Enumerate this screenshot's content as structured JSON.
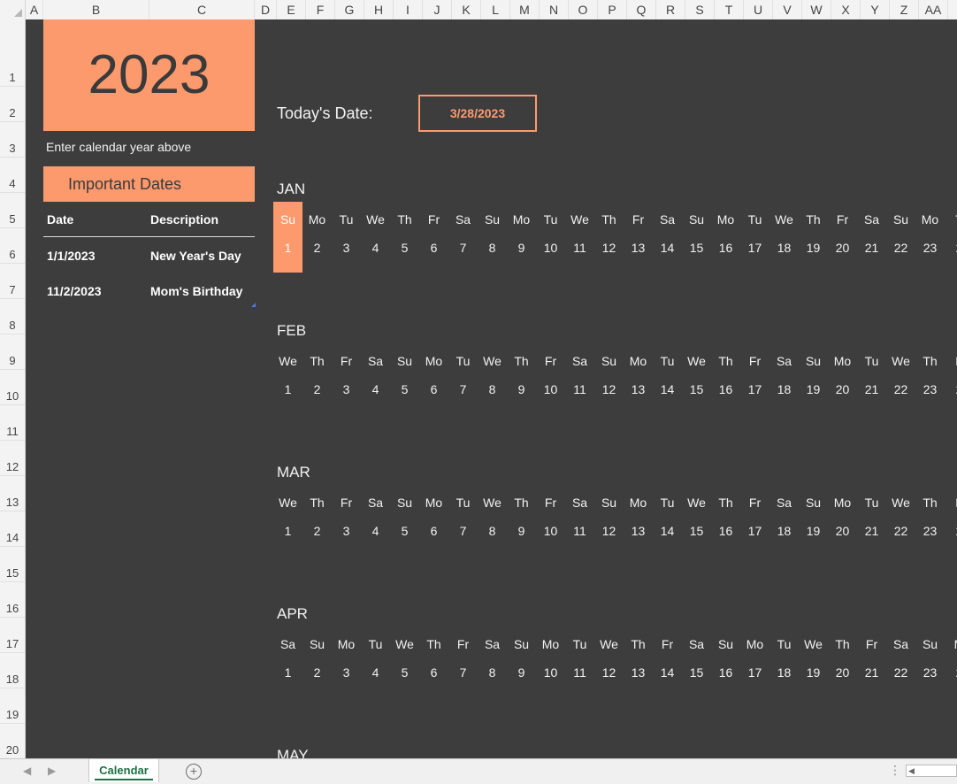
{
  "columns": [
    {
      "label": "A",
      "w": 20
    },
    {
      "label": "B",
      "w": 120
    },
    {
      "label": "C",
      "w": 119
    },
    {
      "label": "D",
      "w": 25
    },
    {
      "label": "E",
      "w": 33
    },
    {
      "label": "F",
      "w": 33
    },
    {
      "label": "G",
      "w": 33
    },
    {
      "label": "H",
      "w": 33
    },
    {
      "label": "I",
      "w": 33
    },
    {
      "label": "J",
      "w": 33
    },
    {
      "label": "K",
      "w": 33
    },
    {
      "label": "L",
      "w": 33
    },
    {
      "label": "M",
      "w": 33
    },
    {
      "label": "N",
      "w": 33
    },
    {
      "label": "O",
      "w": 33
    },
    {
      "label": "P",
      "w": 33
    },
    {
      "label": "Q",
      "w": 33
    },
    {
      "label": "R",
      "w": 33
    },
    {
      "label": "S",
      "w": 33
    },
    {
      "label": "T",
      "w": 33
    },
    {
      "label": "U",
      "w": 33
    },
    {
      "label": "V",
      "w": 33
    },
    {
      "label": "W",
      "w": 33
    },
    {
      "label": "X",
      "w": 33
    },
    {
      "label": "Y",
      "w": 33
    },
    {
      "label": "Z",
      "w": 33
    },
    {
      "label": "AA",
      "w": 33
    },
    {
      "label": "A",
      "w": 33
    }
  ],
  "rows": [
    "1",
    "2",
    "3",
    "4",
    "5",
    "6",
    "7",
    "8",
    "9",
    "10",
    "11",
    "12",
    "13",
    "14",
    "15",
    "16",
    "17",
    "18",
    "19",
    "20"
  ],
  "year": "2023",
  "year_hint": "Enter calendar year above",
  "important_dates": {
    "header": "Important Dates",
    "col_date": "Date",
    "col_desc": "Description",
    "events": [
      {
        "date": "1/1/2023",
        "desc": "New Year's Day"
      },
      {
        "date": "11/2/2023",
        "desc": "Mom's Birthday"
      }
    ]
  },
  "today": {
    "label": "Today's Date:",
    "value": "3/28/2023"
  },
  "months": [
    {
      "name": "JAN",
      "days": [
        "Su",
        "Mo",
        "Tu",
        "We",
        "Th",
        "Fr",
        "Sa",
        "Su",
        "Mo",
        "Tu",
        "We",
        "Th",
        "Fr",
        "Sa",
        "Su",
        "Mo",
        "Tu",
        "We",
        "Th",
        "Fr",
        "Sa",
        "Su",
        "Mo",
        "T"
      ],
      "highlight": 0
    },
    {
      "name": "FEB",
      "days": [
        "We",
        "Th",
        "Fr",
        "Sa",
        "Su",
        "Mo",
        "Tu",
        "We",
        "Th",
        "Fr",
        "Sa",
        "Su",
        "Mo",
        "Tu",
        "We",
        "Th",
        "Fr",
        "Sa",
        "Su",
        "Mo",
        "Tu",
        "We",
        "Th",
        "F"
      ]
    },
    {
      "name": "MAR",
      "days": [
        "We",
        "Th",
        "Fr",
        "Sa",
        "Su",
        "Mo",
        "Tu",
        "We",
        "Th",
        "Fr",
        "Sa",
        "Su",
        "Mo",
        "Tu",
        "We",
        "Th",
        "Fr",
        "Sa",
        "Su",
        "Mo",
        "Tu",
        "We",
        "Th",
        "F"
      ]
    },
    {
      "name": "APR",
      "days": [
        "Sa",
        "Su",
        "Mo",
        "Tu",
        "We",
        "Th",
        "Fr",
        "Sa",
        "Su",
        "Mo",
        "Tu",
        "We",
        "Th",
        "Fr",
        "Sa",
        "Su",
        "Mo",
        "Tu",
        "We",
        "Th",
        "Fr",
        "Sa",
        "Su",
        "M"
      ]
    },
    {
      "name": "MAY",
      "days": []
    }
  ],
  "dates": [
    "1",
    "2",
    "3",
    "4",
    "5",
    "6",
    "7",
    "8",
    "9",
    "10",
    "11",
    "12",
    "13",
    "14",
    "15",
    "16",
    "17",
    "18",
    "19",
    "20",
    "21",
    "22",
    "23",
    "2"
  ],
  "sheet_tab": "Calendar",
  "add_sheet_label": "+",
  "more_label": "⋮",
  "nav_prev": "◀",
  "nav_next": "▶",
  "scroll_left": "◀",
  "colors": {
    "accent": "#fc9a6e",
    "background": "#3d3d3d",
    "tab_green": "#1e7145"
  }
}
